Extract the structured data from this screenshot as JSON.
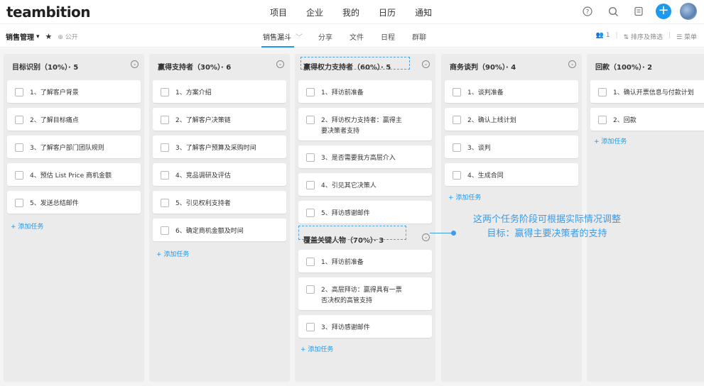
{
  "app": {
    "logo": "teambition"
  },
  "topnav": [
    "项目",
    "企业",
    "我的",
    "日历",
    "通知"
  ],
  "topicons": {
    "help": "?",
    "search": "⌕",
    "notes": "▤",
    "plus": "+"
  },
  "project": {
    "name": "销售管理",
    "caret": "▾",
    "star": "★",
    "visibility": "⊕ 公开"
  },
  "views": {
    "active": "销售漏斗",
    "caret": "﹀",
    "items": [
      "分享",
      "文件",
      "日程",
      "群聊"
    ]
  },
  "subright": {
    "members": "👥 1",
    "sort": "⇅ 排序及筛选",
    "menu": "☰ 菜单"
  },
  "columns": [
    {
      "title": "目标识别（10%）· 5",
      "tasks": [
        "1、了解客户背景",
        "2、了解目标痛点",
        "3、了解客户部门团队规则",
        "4、预估 List Price 商机金额",
        "5、发送总结邮件"
      ]
    },
    {
      "title": "赢得支持者（30%）· 6",
      "tasks": [
        "1、方案介绍",
        "2、了解客户决策链",
        "3、了解客户预算及采购时间",
        "4、竞品调研及评估",
        "5、引见权利支持者",
        "6、确定商机金额及时间"
      ]
    },
    {
      "title": "赢得权力支持者（60%）· 5",
      "tasks": [
        "1、拜访前准备",
        "2、拜访权力支持者：赢得主要决策者支持",
        "3、是否需要我方高层介入",
        "4、引见其它决策人",
        "5、拜访感谢邮件"
      ],
      "subgroup": {
        "title": "覆盖关键人物（70%）· 3",
        "tasks": [
          "1、拜访前准备",
          "2、高层拜访：赢得具有一票否决权的高管支持",
          "3、拜访感谢邮件"
        ]
      }
    },
    {
      "title": "商务谈判（90%）· 4",
      "tasks": [
        "1、谈判准备",
        "2、确认上线计划",
        "3、谈判",
        "4、生成合同"
      ]
    },
    {
      "title": "回款（100%）· 2",
      "tasks": [
        "1、确认开票信息与付款计划",
        "2、回款"
      ]
    }
  ],
  "add_task_label": "+ 添加任务",
  "annotation": {
    "line1": "这两个任务阶段可根据实际情况调整",
    "line2": "目标：赢得主要决策者的支持"
  },
  "colors": {
    "accent": "#1b9aee",
    "annotation": "#3d9be9"
  }
}
